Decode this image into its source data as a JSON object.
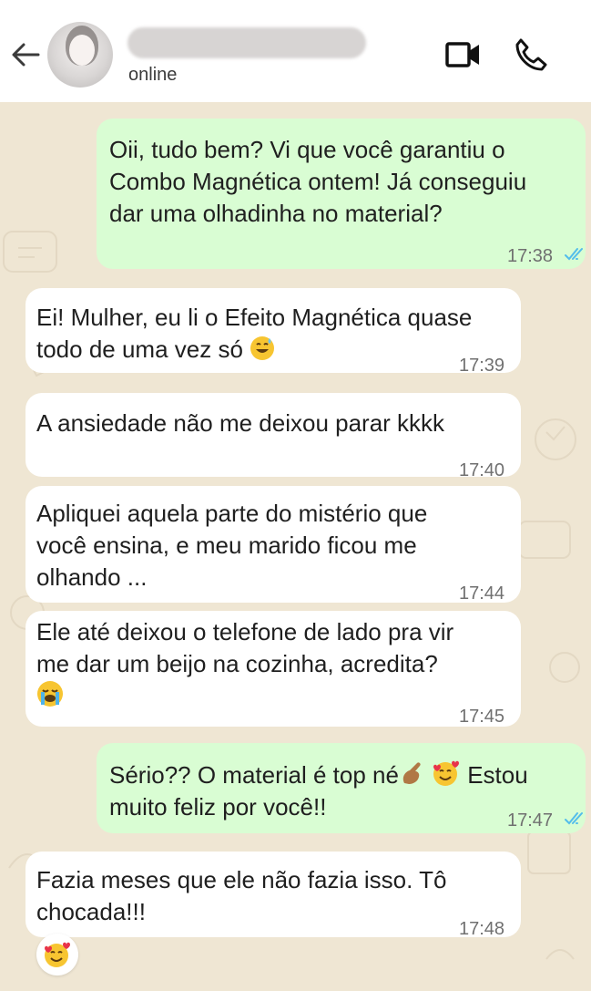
{
  "header": {
    "status": "online"
  },
  "messages": [
    {
      "direction": "out",
      "text": "Oii, tudo bem? Vi que você garantiu o\nCombo Magnética ontem! Já conseguiu\ndar uma olhadinha no material?",
      "time": "17:38",
      "read": true
    },
    {
      "direction": "in",
      "text": "Ei! Mulher, eu li o Efeito Magnética quase\ntodo de uma vez só",
      "emoji": "grinning-sweat-emoji",
      "time": "17:39"
    },
    {
      "direction": "in",
      "text": "A ansiedade não me deixou parar kkkk",
      "time": "17:40"
    },
    {
      "direction": "in",
      "text": "Apliquei aquela parte do mistério que\nvocê ensina, e meu marido ficou me\nolhando ...",
      "time": "17:44"
    },
    {
      "direction": "in",
      "text": "Ele até deixou o telefone de lado pra vir\nme dar um beijo na cozinha, acredita?",
      "emoji": "loudly-crying-emoji",
      "time": "17:45"
    },
    {
      "direction": "out",
      "text_a": "Sério?? O material é top né",
      "text_b": " Estou",
      "text_c": "muito feliz por você!!",
      "emoji": [
        "pinching-hand-emoji",
        "smiling-hearts-emoji"
      ],
      "time": "17:47",
      "read": true
    },
    {
      "direction": "in",
      "text": "Fazia meses que ele não fazia isso. Tô\nchocada!!!",
      "time": "17:48",
      "reaction": "smiling-hearts-emoji"
    }
  ],
  "icons": [
    "back-arrow-icon",
    "video-call-icon",
    "phone-call-icon",
    "double-check-icon"
  ],
  "colors": {
    "outgoing_bubble": "#d9fdd3",
    "incoming_bubble": "#ffffff",
    "chat_background": "#efe6d3",
    "read_ticks": "#53bdeb"
  }
}
